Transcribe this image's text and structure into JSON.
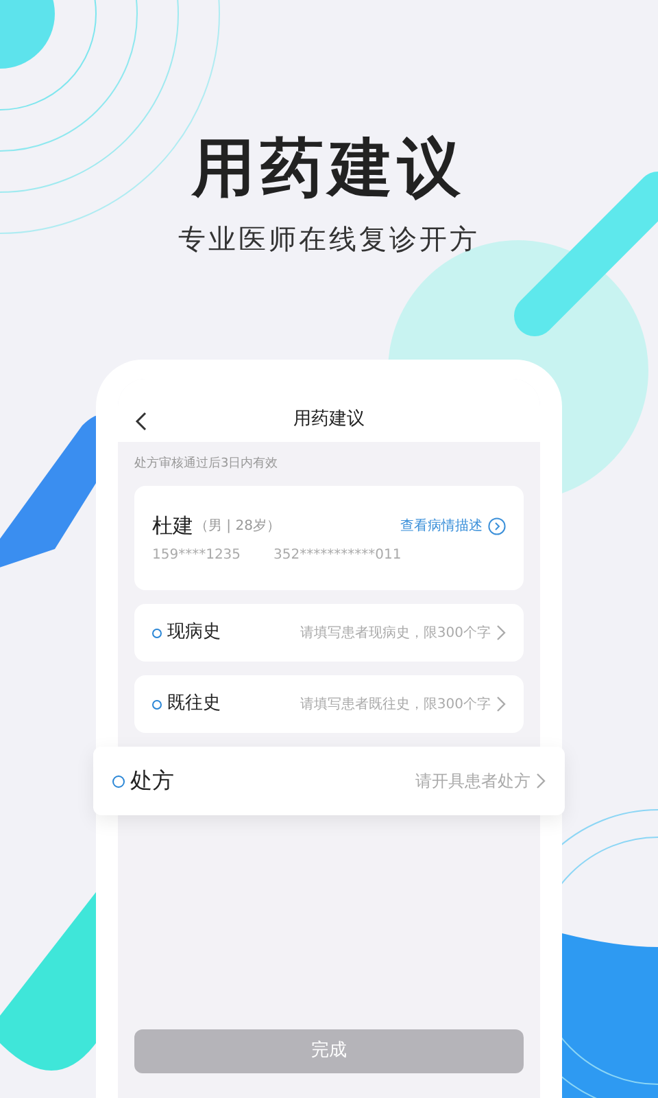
{
  "headline": "用药建议",
  "subtitle": "专业医师在线复诊开方",
  "screen": {
    "title": "用药建议",
    "notice": "处方审核通过后3日内有效",
    "patient": {
      "name": "杜建",
      "info": "（男 | 28岁）",
      "phone": "159****1235",
      "id_number": "352***********011",
      "link": "查看病情描述"
    },
    "rows": [
      {
        "label": "现病史",
        "placeholder": "请填写患者现病史，限300个字",
        "highlighted": false
      },
      {
        "label": "既往史",
        "placeholder": "请填写患者既往史，限300个字",
        "highlighted": false
      },
      {
        "label": "处方",
        "placeholder": "请开具患者处方",
        "highlighted": true
      }
    ],
    "button": {
      "label": "完成",
      "disabled": true
    }
  }
}
